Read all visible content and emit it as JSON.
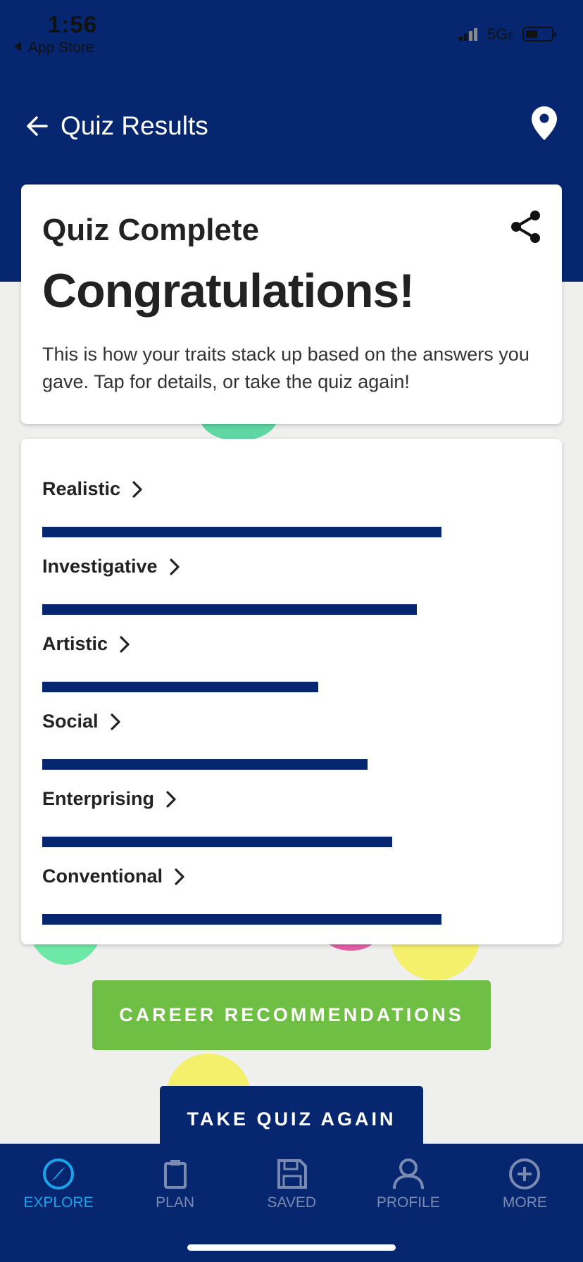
{
  "status_bar": {
    "time": "1:56",
    "back_app": "App Store",
    "network": "5G",
    "network_suffix": "E"
  },
  "nav": {
    "title": "Quiz Results"
  },
  "summary": {
    "heading": "Quiz Complete",
    "congrats": "Congratulations!",
    "description": "This is how your traits stack up based on the answers you gave. Tap for details, or take the quiz again!"
  },
  "traits": [
    {
      "label": "Realistic",
      "score": 0.81
    },
    {
      "label": "Investigative",
      "score": 0.76
    },
    {
      "label": "Artistic",
      "score": 0.56
    },
    {
      "label": "Social",
      "score": 0.66
    },
    {
      "label": "Enterprising",
      "score": 0.71
    },
    {
      "label": "Conventional",
      "score": 0.81
    }
  ],
  "buttons": {
    "career": "CAREER RECOMMENDATIONS",
    "retake": "TAKE QUIZ AGAIN"
  },
  "tabs": [
    {
      "label": "EXPLORE",
      "icon": "compass-icon",
      "active": true
    },
    {
      "label": "PLAN",
      "icon": "clipboard-icon",
      "active": false
    },
    {
      "label": "SAVED",
      "icon": "floppy-disk-icon",
      "active": false
    },
    {
      "label": "PROFILE",
      "icon": "person-icon",
      "active": false
    },
    {
      "label": "MORE",
      "icon": "plus-circle-icon",
      "active": false
    }
  ],
  "colors": {
    "header": "#06276f",
    "bar": "#06276f",
    "green_button": "#70bf45",
    "active_tab": "#1aa3e8",
    "inactive_tab": "#7b8ab0"
  }
}
